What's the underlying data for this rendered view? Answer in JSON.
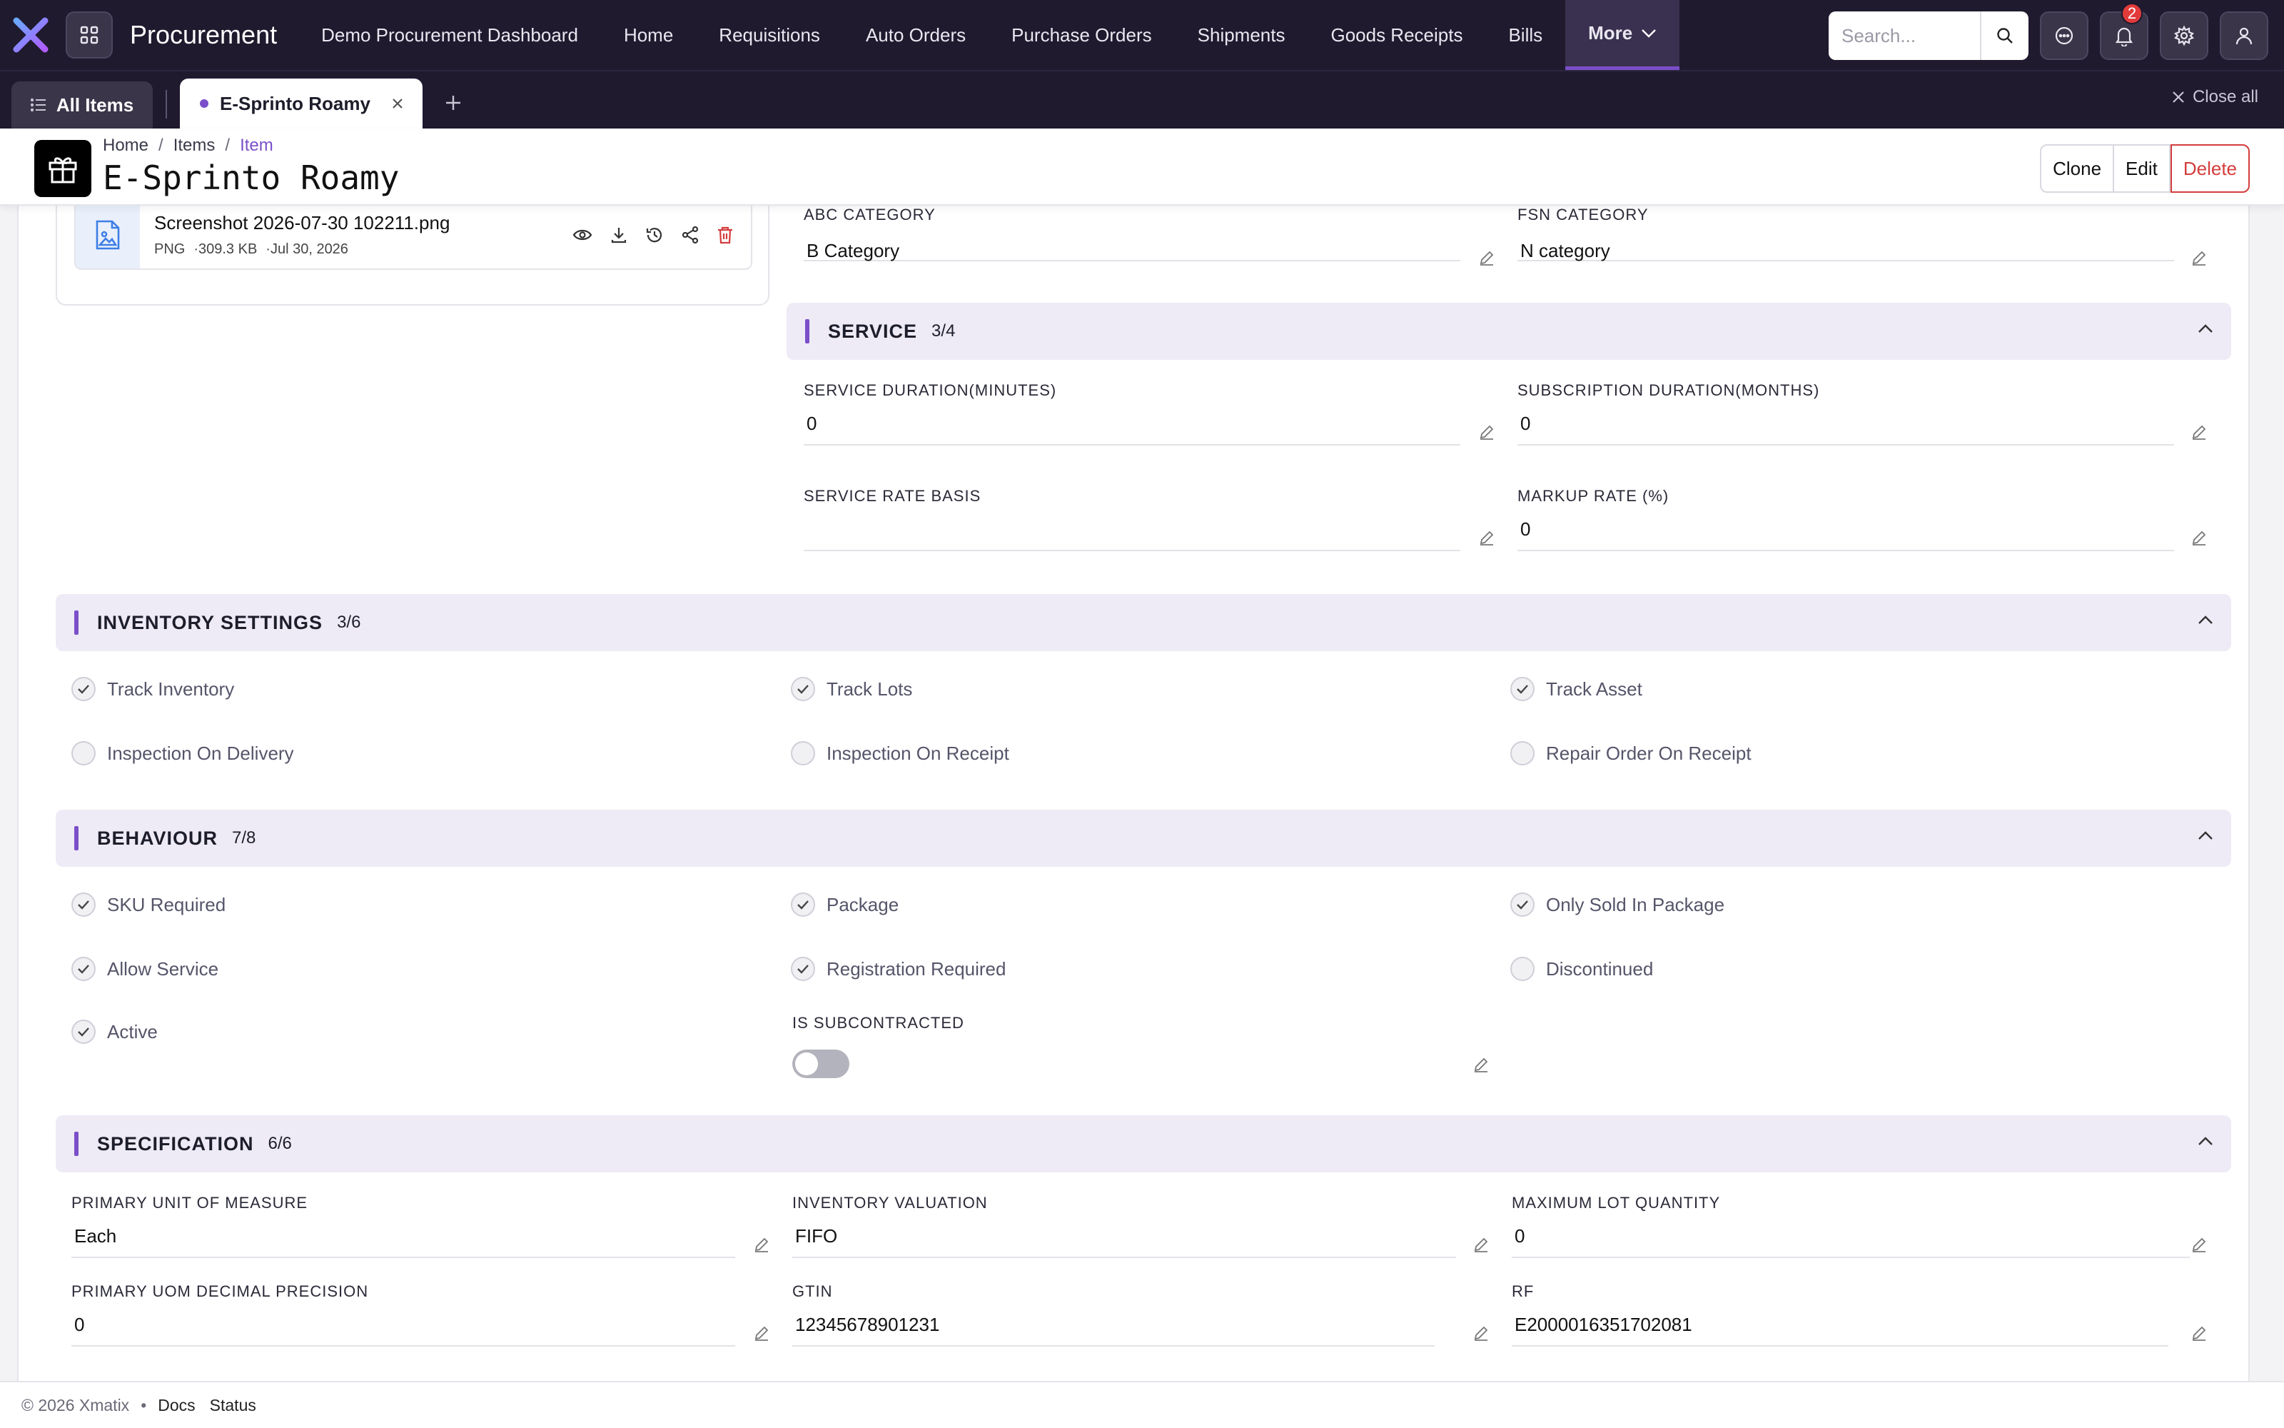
{
  "app": {
    "title": "Procurement",
    "nav": [
      "Demo Procurement Dashboard",
      "Home",
      "Requisitions",
      "Auto Orders",
      "Purchase Orders",
      "Shipments",
      "Goods Receipts",
      "Bills"
    ],
    "more_label": "More",
    "search_placeholder": "Search...",
    "notification_count": "2",
    "accent_color": "#7b4fc9"
  },
  "tabs": {
    "all_label": "All Items",
    "active_label": "E-Sprinto Roamy",
    "close_all_label": "Close all"
  },
  "header": {
    "breadcrumb": [
      "Home",
      "Items",
      "Item"
    ],
    "title": "E-Sprinto Roamy",
    "actions": {
      "clone": "Clone",
      "edit": "Edit",
      "delete": "Delete"
    }
  },
  "attachment": {
    "name": "Screenshot 2026-07-30 102211.png",
    "type": "PNG",
    "size": "·309.3 KB",
    "date": "·Jul 30, 2026"
  },
  "categories": {
    "abc_label": "ABC CATEGORY",
    "abc_value": "B Category",
    "fsn_label": "FSN CATEGORY",
    "fsn_value": "N category"
  },
  "service": {
    "title": "SERVICE",
    "count": "3/4",
    "fields": {
      "duration_label": "SERVICE DURATION(MINUTES)",
      "duration_value": "0",
      "subscription_label": "SUBSCRIPTION DURATION(MONTHS)",
      "subscription_value": "0",
      "rate_basis_label": "SERVICE RATE BASIS",
      "rate_basis_value": "",
      "markup_label": "MARKUP RATE (%)",
      "markup_value": "0"
    }
  },
  "inventory": {
    "title": "INVENTORY SETTINGS",
    "count": "3/6",
    "checks": [
      {
        "label": "Track Inventory",
        "checked": true
      },
      {
        "label": "Track Lots",
        "checked": true
      },
      {
        "label": "Track Asset",
        "checked": true
      },
      {
        "label": "Inspection On Delivery",
        "checked": false
      },
      {
        "label": "Inspection On Receipt",
        "checked": false
      },
      {
        "label": "Repair Order On Receipt",
        "checked": false
      }
    ]
  },
  "behaviour": {
    "title": "BEHAVIOUR",
    "count": "7/8",
    "checks": [
      {
        "label": "SKU Required",
        "checked": true
      },
      {
        "label": "Package",
        "checked": true
      },
      {
        "label": "Only Sold In Package",
        "checked": true
      },
      {
        "label": "Allow Service",
        "checked": true
      },
      {
        "label": "Registration Required",
        "checked": true
      },
      {
        "label": "Discontinued",
        "checked": false
      },
      {
        "label": "Active",
        "checked": true
      }
    ],
    "subcontracted_label": "IS SUBCONTRACTED",
    "subcontracted_on": false
  },
  "specification": {
    "title": "SPECIFICATION",
    "count": "6/6",
    "fields": {
      "uom_label": "PRIMARY UNIT OF MEASURE",
      "uom_value": "Each",
      "valuation_label": "INVENTORY VALUATION",
      "valuation_value": "FIFO",
      "max_lot_label": "MAXIMUM LOT QUANTITY",
      "max_lot_value": "0",
      "precision_label": "PRIMARY UOM DECIMAL PRECISION",
      "precision_value": "0",
      "gtin_label": "GTIN",
      "gtin_value": "12345678901231",
      "rf_label": "RF",
      "rf_value": "E2000016351702081"
    }
  },
  "footer": {
    "copyright": "© 2026 Xmatix",
    "links": [
      "Docs",
      "Status"
    ]
  }
}
